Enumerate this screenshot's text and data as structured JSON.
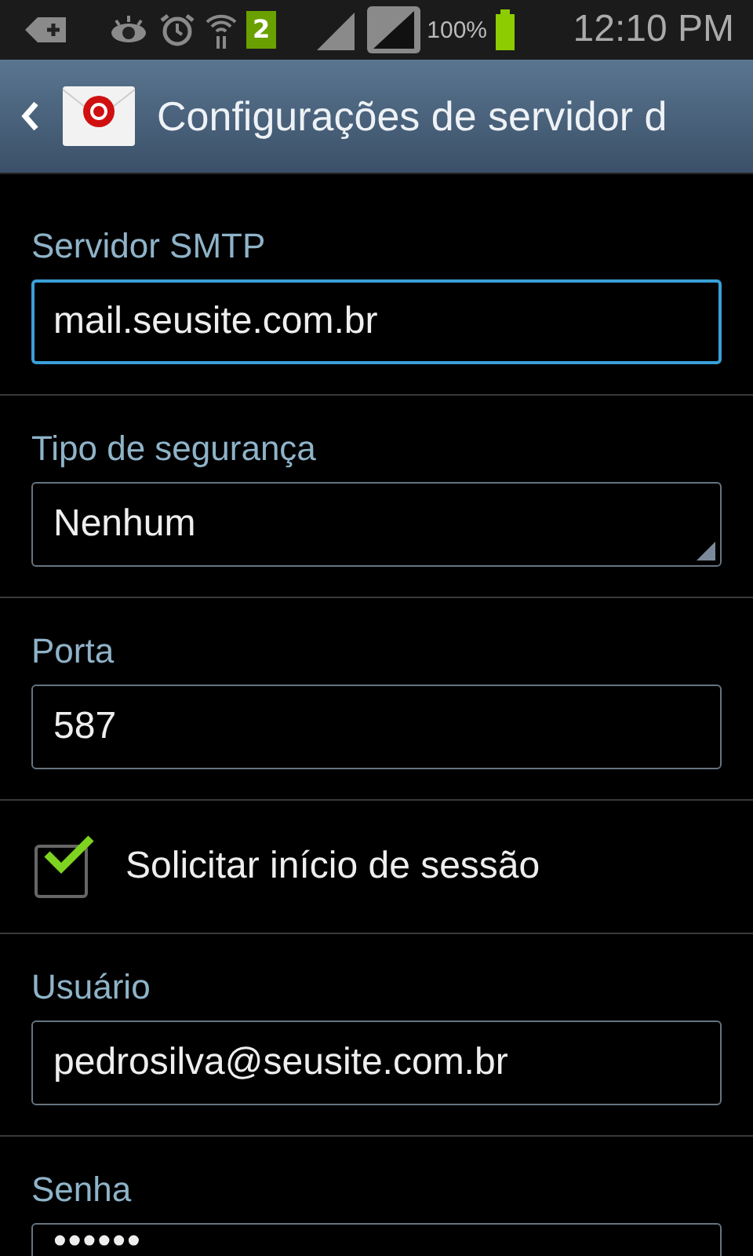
{
  "status_bar": {
    "sim_badge": "2",
    "battery": "100%",
    "time": "12:10 PM"
  },
  "action_bar": {
    "title": "Configurações de servidor d"
  },
  "settings": [
    {
      "kind": "field",
      "label": "Servidor SMTP",
      "value": "mail.seusite.com.br",
      "focused": true
    },
    {
      "kind": "dropdown",
      "label": "Tipo de segurança",
      "value": "Nenhum",
      "focused": false
    },
    {
      "kind": "field",
      "label": "Porta",
      "value": "587",
      "focused": false
    },
    {
      "kind": "checkbox",
      "label": "Solicitar início de sessão",
      "checked": true
    },
    {
      "kind": "field",
      "label": "Usuário",
      "value": "pedrosilva@seusite.com.br",
      "focused": false
    },
    {
      "kind": "password",
      "label": "Senha",
      "value": "••••••",
      "focused": false
    }
  ]
}
